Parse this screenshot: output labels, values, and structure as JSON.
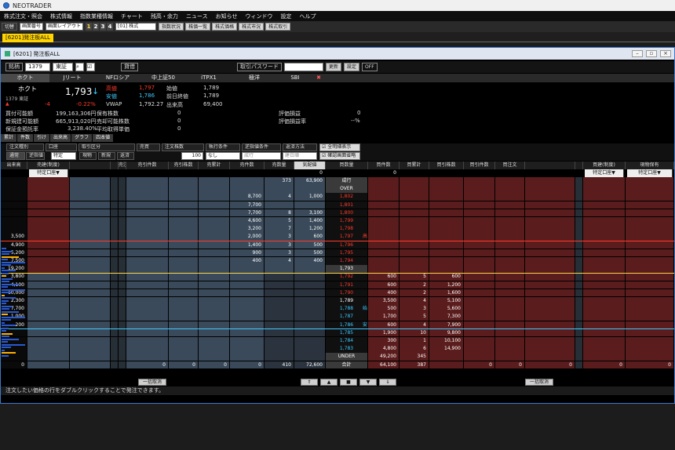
{
  "app": {
    "title": "NEOTRADER"
  },
  "menu": [
    "株式注文・照会",
    "株式情報",
    "指数業種情報",
    "チャート",
    "残高・余力",
    "ニュース",
    "お知らせ",
    "ウィンドウ",
    "設定",
    "ヘルプ"
  ],
  "toolbar": {
    "tab_label": "切替",
    "selector1": "画面番号",
    "layout": "画面レイアウト",
    "pages": [
      "1",
      "2",
      "3",
      "4"
    ],
    "market_select": "[01] 株式",
    "buttons": [
      "指数状況",
      "株価一覧",
      "株式価格",
      "株式市況",
      "株式取引"
    ]
  },
  "doc_tab": "[6201]発注板ALL",
  "window": {
    "title": "[6201] 発注板ALL"
  },
  "inputs": {
    "code_label": "銘柄",
    "code": "1379",
    "market": "東証",
    "buy_label": "貸借",
    "password_label": "取引パスワード",
    "password_value": "",
    "refresh": "更新",
    "settings": "設定",
    "off": "OFF"
  },
  "stock_tabs": [
    "ホクト",
    "Jリート",
    "NFロシア",
    "中上証50",
    "iTPX1",
    "極洋",
    "SBI"
  ],
  "quote": {
    "name": "ホクト",
    "code_market": "1379 東証",
    "price": "1,793",
    "arrow": "↓",
    "change": "-4",
    "change_pct": "-0.22%",
    "high_label": "高値",
    "high": "1,797",
    "low_label": "安値",
    "low": "1,786",
    "vwap_label": "VWAP",
    "vwap": "1,792.27",
    "open_label": "始値",
    "open": "1,789",
    "prev_label": "前日終値",
    "prev": "1,789",
    "volume_label": "出来高",
    "volume": "69,400"
  },
  "account": {
    "buy_power_label": "買付可能額",
    "buy_power": "199,163,306円",
    "new_margin_label": "新規建可能額",
    "new_margin": "665,913,020円",
    "margin_rate_label": "保証金預託率",
    "margin_rate": "3,238.40%",
    "holdings_label": "保有株数",
    "holdings": "0",
    "sell_label": "売却可能株数",
    "sell": "0",
    "avg_label": "平均取得単価",
    "avg": "0",
    "eval_label": "評価損益",
    "eval": "0",
    "eval_rate_label": "評価損益率",
    "eval_rate": "--%"
  },
  "sub_tabs": [
    "累計",
    "件数",
    "引け",
    "出来高",
    "グラフ",
    "四本値"
  ],
  "order_form": {
    "type_label": "注文種別",
    "account_label": "口座",
    "trade_label": "取引区分",
    "side_label": "売買",
    "qty_label": "注文株数",
    "cond_label": "執行条件",
    "stop_label": "逆指値条件",
    "expire_label": "返済方法",
    "normal": "通常",
    "stop": "逆指値",
    "account": "特定",
    "cash": "現物",
    "new": "新規",
    "close": "返済",
    "qty": "100",
    "cond": "なし",
    "stop_val": "成行",
    "expire": "建日順",
    "check1": "全明細表示",
    "check2": "確認画面省略"
  },
  "grid_headers": {
    "left": [
      "出来高",
      "売建(制度)",
      "",
      "",
      "売注文",
      "売引件数",
      "売引株数",
      "売累計",
      "売件数",
      "売数量",
      "気配値",
      "買数量",
      "買件数",
      "買累計",
      "買引株数",
      "買引件数",
      "買注文",
      "",
      "",
      "買建(制度)",
      "現物保有"
    ],
    "sub_account": "特定口座▼"
  },
  "ladder": [
    {
      "vol": "",
      "scum": "",
      "scnt": "373",
      "sq": "63,900",
      "price": "成行",
      "pc": "white",
      "bq": "",
      "bc": "",
      "bcum": "",
      "mark": ""
    },
    {
      "vol": "",
      "scum": "",
      "scnt": "",
      "sq": "",
      "price": "OVER",
      "pc": "white",
      "bq": "",
      "bc": "",
      "bcum": "",
      "mark": ""
    },
    {
      "vol": "",
      "scum": "8,700",
      "scnt": "4",
      "sq": "1,000",
      "price": "1,802",
      "pc": "red",
      "bq": "",
      "bc": "",
      "bcum": "",
      "mark": ""
    },
    {
      "vol": "",
      "scum": "7,700",
      "scnt": "",
      "sq": "",
      "price": "1,801",
      "pc": "red",
      "bq": "",
      "bc": "",
      "bcum": "",
      "mark": ""
    },
    {
      "vol": "",
      "scum": "7,700",
      "scnt": "8",
      "sq": "3,100",
      "price": "1,800",
      "pc": "red",
      "bq": "",
      "bc": "",
      "bcum": "",
      "mark": ""
    },
    {
      "vol": "",
      "scum": "4,600",
      "scnt": "5",
      "sq": "1,400",
      "price": "1,799",
      "pc": "red",
      "bq": "",
      "bc": "",
      "bcum": "",
      "mark": ""
    },
    {
      "vol": "",
      "scum": "3,200",
      "scnt": "7",
      "sq": "1,200",
      "price": "1,798",
      "pc": "red",
      "bq": "",
      "bc": "",
      "bcum": "",
      "mark": ""
    },
    {
      "vol": "3,500",
      "scum": "2,000",
      "scnt": "3",
      "sq": "600",
      "price": "1,797",
      "pc": "red",
      "bq": "",
      "bc": "",
      "bcum": "",
      "mark": "高"
    },
    {
      "vol": "4,900",
      "scum": "1,400",
      "scnt": "3",
      "sq": "500",
      "price": "1,796",
      "pc": "red",
      "bq": "",
      "bc": "",
      "bcum": "",
      "mark": ""
    },
    {
      "vol": "5,200",
      "scum": "900",
      "scnt": "3",
      "sq": "500",
      "price": "1,795",
      "pc": "red",
      "bq": "",
      "bc": "",
      "bcum": "",
      "mark": ""
    },
    {
      "vol": "7,500",
      "scum": "400",
      "scnt": "4",
      "sq": "400",
      "price": "1,794",
      "pc": "red",
      "bq": "",
      "bc": "",
      "bcum": "",
      "mark": ""
    },
    {
      "vol": "19,200",
      "scum": "",
      "scnt": "",
      "sq": "",
      "price": "1,793",
      "pc": "white",
      "bq": "",
      "bc": "",
      "bcum": "",
      "mark": ""
    },
    {
      "vol": "3,800",
      "scum": "",
      "scnt": "",
      "sq": "",
      "price": "1,792",
      "pc": "red",
      "bq": "600",
      "bc": "5",
      "bcum": "600",
      "mark": ""
    },
    {
      "vol": "4,100",
      "scum": "",
      "scnt": "",
      "sq": "",
      "price": "1,791",
      "pc": "red",
      "bq": "600",
      "bc": "2",
      "bcum": "1,200",
      "mark": ""
    },
    {
      "vol": "10,000",
      "scum": "",
      "scnt": "",
      "sq": "",
      "price": "1,790",
      "pc": "red",
      "bq": "400",
      "bc": "2",
      "bcum": "1,600",
      "mark": ""
    },
    {
      "vol": "2,300",
      "scum": "",
      "scnt": "",
      "sq": "",
      "price": "1,789",
      "pc": "white",
      "bq": "3,500",
      "bc": "4",
      "bcum": "5,100",
      "mark": ""
    },
    {
      "vol": "7,700",
      "scum": "",
      "scnt": "",
      "sq": "",
      "price": "1,788",
      "pc": "cyan",
      "bq": "500",
      "bc": "3",
      "bcum": "5,600",
      "mark": "始"
    },
    {
      "vol": "1,000",
      "scum": "",
      "scnt": "",
      "sq": "",
      "price": "1,787",
      "pc": "cyan",
      "bq": "1,700",
      "bc": "5",
      "bcum": "7,300",
      "mark": ""
    },
    {
      "vol": "200",
      "scum": "",
      "scnt": "",
      "sq": "",
      "price": "1,786",
      "pc": "cyan",
      "bq": "600",
      "bc": "4",
      "bcum": "7,900",
      "mark": "安"
    },
    {
      "vol": "",
      "scum": "",
      "scnt": "",
      "sq": "",
      "price": "1,785",
      "pc": "cyan",
      "bq": "1,900",
      "bc": "10",
      "bcum": "9,800",
      "mark": ""
    },
    {
      "vol": "",
      "scum": "",
      "scnt": "",
      "sq": "",
      "price": "1,784",
      "pc": "cyan",
      "bq": "300",
      "bc": "1",
      "bcum": "10,100",
      "mark": ""
    },
    {
      "vol": "",
      "scum": "",
      "scnt": "",
      "sq": "",
      "price": "1,783",
      "pc": "cyan",
      "bq": "4,800",
      "bc": "6",
      "bcum": "14,900",
      "mark": ""
    },
    {
      "vol": "",
      "scum": "",
      "scnt": "",
      "sq": "",
      "price": "UNDER",
      "pc": "white",
      "bq": "49,200",
      "bc": "345",
      "bcum": "",
      "mark": ""
    },
    {
      "vol": "",
      "scum": "0",
      "scnt": "410",
      "sq": "72,600",
      "price": "合計",
      "pc": "white",
      "bq": "64,100",
      "bc": "387",
      "bcum": "",
      "mark": ""
    }
  ],
  "totals": {
    "vol": "0",
    "sorder": "0",
    "scnt": "0",
    "sshares": "0",
    "border": "0",
    "bcnt": "0",
    "bshares": "0",
    "buy_m": "0",
    "stock": "0",
    "top_sell": "0",
    "top_buy": "0"
  },
  "bottom": {
    "cancel_all_left": "一括取消",
    "cancel_all_right": "一括取消",
    "nav": [
      "⇑",
      "▲",
      "■",
      "▼",
      "⇓"
    ]
  },
  "status": "注文したい価格の行をダブルクリックすることで発注できます。",
  "colors": {
    "accent": "#ffd400",
    "sell_bg": "#3a4a5a",
    "buy_bg": "#5a1c1c",
    "grid_dark": "#262e36",
    "red": "#ff3a2a",
    "cyan": "#3fc8ff"
  }
}
